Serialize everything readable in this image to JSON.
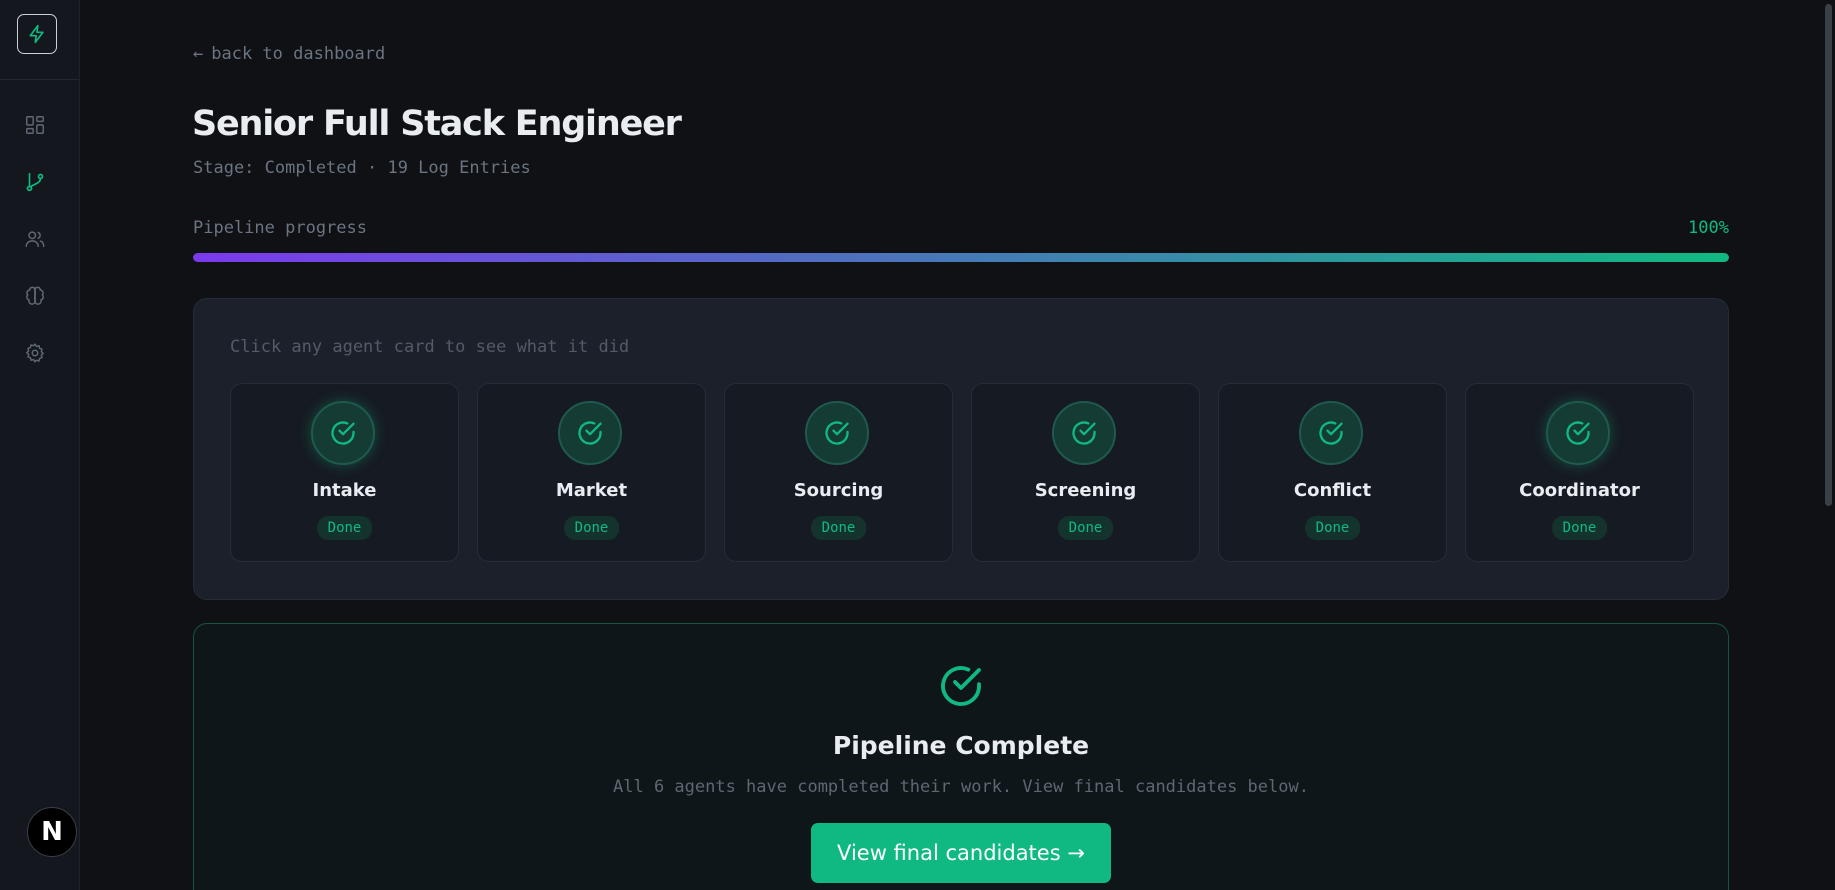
{
  "theme": {
    "background": "#0f1115",
    "accent": "#10b981",
    "progress_gradient_start": "#7c3aed",
    "progress_gradient_end": "#10b981"
  },
  "sidebar": {
    "logo_icon": "lightning-bolt-icon",
    "items": [
      {
        "name": "dashboard",
        "icon": "grid-icon",
        "active": false
      },
      {
        "name": "pipelines",
        "icon": "git-branch-icon",
        "active": true
      },
      {
        "name": "candidates",
        "icon": "users-icon",
        "active": false
      },
      {
        "name": "intelligence",
        "icon": "brain-icon",
        "active": false
      },
      {
        "name": "settings",
        "icon": "gear-icon",
        "active": false
      }
    ],
    "avatar_letter": "N"
  },
  "header": {
    "back_label": "back to dashboard",
    "title": "Senior Full Stack Engineer",
    "subtitle": "Stage: Completed · 19 Log Entries"
  },
  "progress": {
    "label": "Pipeline progress",
    "value_text": "100%",
    "fraction": 1.0
  },
  "agents": {
    "hint": "Click any agent card to see what it did",
    "items": [
      {
        "name": "Intake",
        "status": "Done"
      },
      {
        "name": "Market",
        "status": "Done"
      },
      {
        "name": "Sourcing",
        "status": "Done"
      },
      {
        "name": "Screening",
        "status": "Done"
      },
      {
        "name": "Conflict",
        "status": "Done"
      },
      {
        "name": "Coordinator",
        "status": "Done"
      }
    ]
  },
  "complete": {
    "title": "Pipeline Complete",
    "description": "All 6 agents have completed their work. View final candidates below.",
    "button_label": "View final candidates →"
  }
}
